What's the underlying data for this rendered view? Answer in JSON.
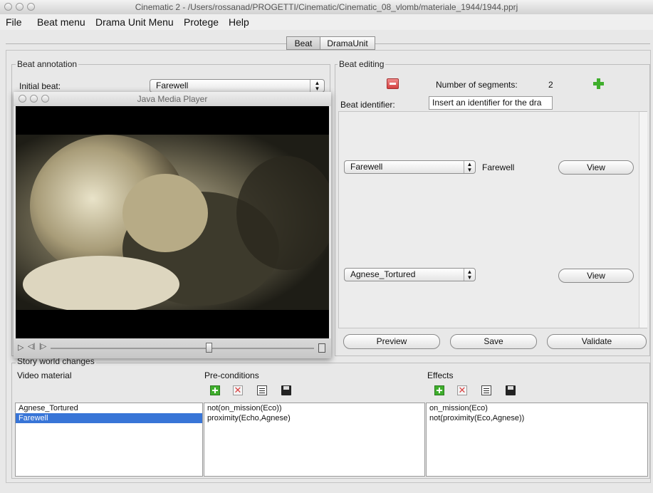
{
  "window": {
    "title": "Cinematic 2 - /Users/rossanad/PROGETTI/Cinematic/Cinematic_08_vlomb/materiale_1944/1944.pprj"
  },
  "menubar": [
    "File",
    "Beat menu",
    "Drama Unit Menu",
    "Protege",
    "Help"
  ],
  "tabs": [
    {
      "label": "Beat",
      "selected": true
    },
    {
      "label": "DramaUnit",
      "selected": false
    }
  ],
  "beat_annotation": {
    "legend": "Beat annotation",
    "initial_beat_label": "Initial beat:",
    "initial_beat_value": "Farewell"
  },
  "media_player": {
    "title": "Java Media Player",
    "controls": [
      "play-icon",
      "step-back-icon",
      "step-forward-icon",
      "position-slider",
      "volume-icon"
    ],
    "position": 0.6
  },
  "beat_editing": {
    "legend": "Beat editing",
    "num_segments_label": "Number of segments:",
    "num_segments_value": "2",
    "identifier_label": "Beat identifier:",
    "identifier_placeholder": "Insert an identifier for the dra",
    "segments": [
      {
        "combo": "Farewell",
        "label": "Farewell",
        "view_label": "View"
      },
      {
        "combo": "Agnese_Tortured",
        "label": "",
        "view_label": "View"
      }
    ],
    "preview_label": "Preview",
    "save_label": "Save",
    "validate_label": "Validate"
  },
  "story_world": {
    "legend": "Story world changes",
    "video_material_label": "Video material",
    "preconditions_label": "Pre-conditions",
    "effects_label": "Effects",
    "video_material": [
      {
        "text": "Agnese_Tortured",
        "selected": false
      },
      {
        "text": "Farewell",
        "selected": true
      }
    ],
    "preconditions": [
      "not(on_mission(Eco))",
      "proximity(Echo,Agnese)"
    ],
    "effects": [
      "on_mission(Eco)",
      "not(proximity(Eco,Agnese))"
    ]
  },
  "colors": {
    "selection": "#3875d7",
    "add_icon": "#2e9e2e",
    "remove_icon": "#d94040",
    "window_bg": "#e8e8e8"
  }
}
